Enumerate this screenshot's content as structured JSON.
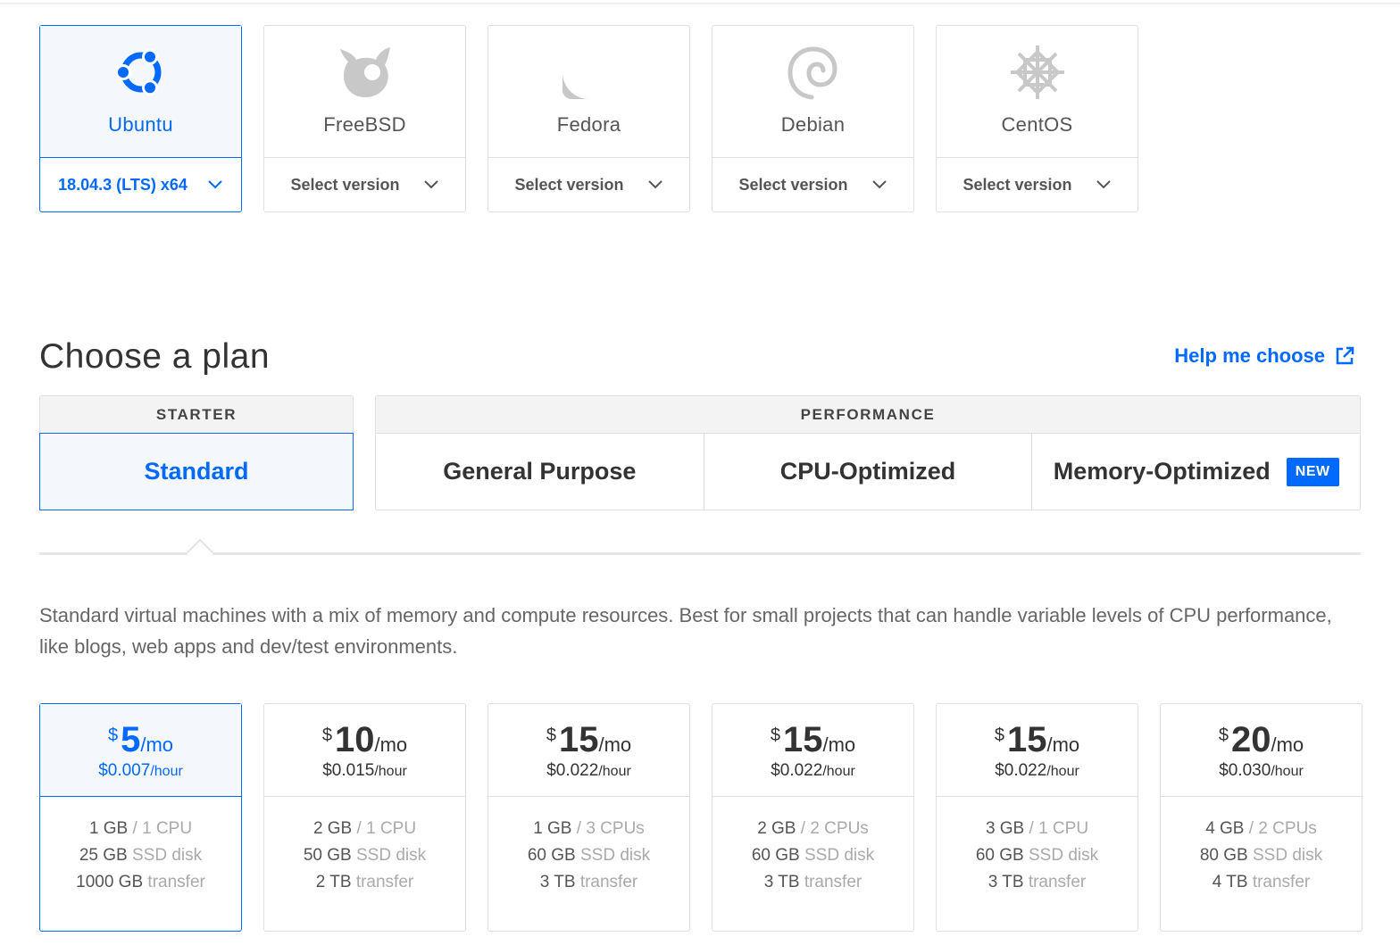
{
  "distros": [
    {
      "name": "Ubuntu",
      "version": "18.04.3 (LTS) x64",
      "icon": "ubuntu-logo-icon",
      "selected": true
    },
    {
      "name": "FreeBSD",
      "version": "Select version",
      "icon": "freebsd-logo-icon",
      "selected": false
    },
    {
      "name": "Fedora",
      "version": "Select version",
      "icon": "fedora-logo-icon",
      "selected": false
    },
    {
      "name": "Debian",
      "version": "Select version",
      "icon": "debian-logo-icon",
      "selected": false
    },
    {
      "name": "CentOS",
      "version": "Select version",
      "icon": "centos-logo-icon",
      "selected": false
    }
  ],
  "plan": {
    "title": "Choose a plan",
    "help_label": "Help me choose",
    "starter_label": "STARTER",
    "performance_label": "PERFORMANCE",
    "tabs": {
      "standard": "Standard",
      "general": "General Purpose",
      "cpu": "CPU-Optimized",
      "memory": "Memory-Optimized",
      "memory_badge": "NEW"
    },
    "description": "Standard virtual machines with a mix of memory and compute resources. Best for small projects that can handle variable levels of CPU performance, like blogs, web apps and dev/test environments."
  },
  "prices": [
    {
      "currency": "$",
      "amount": "5",
      "per": "/mo",
      "hourly": "$0.007",
      "hour_unit": "/hour",
      "ram": "1 GB",
      "cpu": "/ 1 CPU",
      "disk": "25 GB",
      "disk_unit": "SSD disk",
      "transfer": "1000 GB",
      "transfer_unit": "transfer",
      "selected": true
    },
    {
      "currency": "$",
      "amount": "10",
      "per": "/mo",
      "hourly": "$0.015",
      "hour_unit": "/hour",
      "ram": "2 GB",
      "cpu": "/ 1 CPU",
      "disk": "50 GB",
      "disk_unit": "SSD disk",
      "transfer": "2 TB",
      "transfer_unit": "transfer",
      "selected": false
    },
    {
      "currency": "$",
      "amount": "15",
      "per": "/mo",
      "hourly": "$0.022",
      "hour_unit": "/hour",
      "ram": "1 GB",
      "cpu": "/ 3 CPUs",
      "disk": "60 GB",
      "disk_unit": "SSD disk",
      "transfer": "3 TB",
      "transfer_unit": "transfer",
      "selected": false
    },
    {
      "currency": "$",
      "amount": "15",
      "per": "/mo",
      "hourly": "$0.022",
      "hour_unit": "/hour",
      "ram": "2 GB",
      "cpu": "/ 2 CPUs",
      "disk": "60 GB",
      "disk_unit": "SSD disk",
      "transfer": "3 TB",
      "transfer_unit": "transfer",
      "selected": false
    },
    {
      "currency": "$",
      "amount": "15",
      "per": "/mo",
      "hourly": "$0.022",
      "hour_unit": "/hour",
      "ram": "3 GB",
      "cpu": "/ 1 CPU",
      "disk": "60 GB",
      "disk_unit": "SSD disk",
      "transfer": "3 TB",
      "transfer_unit": "transfer",
      "selected": false
    },
    {
      "currency": "$",
      "amount": "20",
      "per": "/mo",
      "hourly": "$0.030",
      "hour_unit": "/hour",
      "ram": "4 GB",
      "cpu": "/ 2 CPUs",
      "disk": "80 GB",
      "disk_unit": "SSD disk",
      "transfer": "4 TB",
      "transfer_unit": "transfer",
      "selected": false
    }
  ],
  "colors": {
    "accent": "#0069ff",
    "muted_logo": "#c8c8c8"
  }
}
